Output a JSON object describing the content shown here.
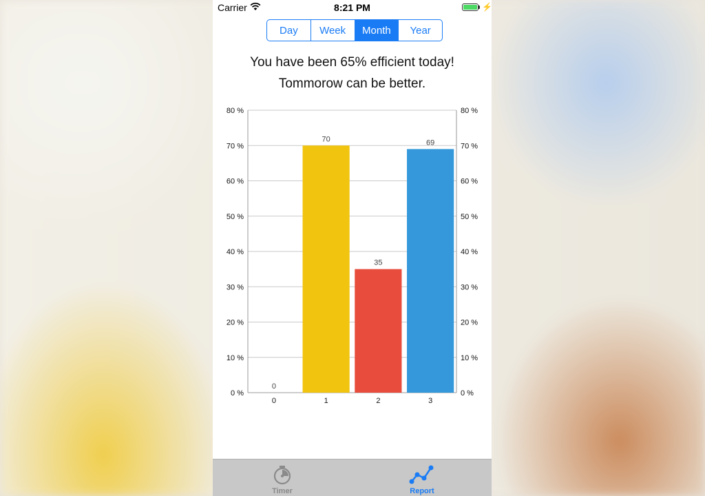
{
  "status_bar": {
    "carrier": "Carrier",
    "time": "8:21 PM"
  },
  "segments": [
    {
      "label": "Day",
      "selected": false
    },
    {
      "label": "Week",
      "selected": false
    },
    {
      "label": "Month",
      "selected": true
    },
    {
      "label": "Year",
      "selected": false
    }
  ],
  "message": {
    "line1": "You have been 65% efficient today!",
    "line2": "Tommorow can be better."
  },
  "chart_data": {
    "type": "bar",
    "categories": [
      "0",
      "1",
      "2",
      "3"
    ],
    "values": [
      0,
      70,
      35,
      69
    ],
    "data_labels": [
      "0",
      "70",
      "35",
      "69"
    ],
    "colors": [
      "#9e9e9e",
      "#f1c40f",
      "#e74c3c",
      "#3498db"
    ],
    "ylim": [
      0,
      80
    ],
    "yticks": [
      "0 %",
      "10 %",
      "20 %",
      "30 %",
      "40 %",
      "50 %",
      "60 %",
      "70 %",
      "80 %"
    ],
    "grid": true,
    "right_axis": true
  },
  "tabbar": {
    "items": [
      {
        "label": "Timer",
        "icon": "stopwatch-icon",
        "selected": false
      },
      {
        "label": "Report",
        "icon": "line-chart-icon",
        "selected": true
      }
    ],
    "accent": "#1a7cf5"
  }
}
